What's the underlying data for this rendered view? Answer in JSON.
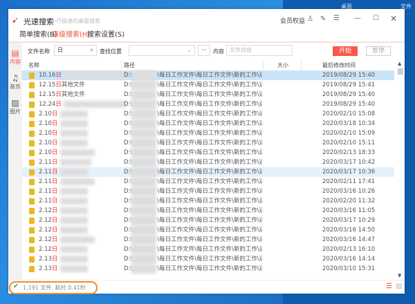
{
  "desktop": {
    "tabs": [
      "桌面",
      "文件"
    ]
  },
  "app": {
    "name": "光速搜索",
    "slogan": "小巧极速的桌面搜索",
    "member": "会员权益"
  },
  "menu": [
    {
      "label": "简单搜索(B)"
    },
    {
      "label": "高级搜索(H)"
    },
    {
      "label": "搜索设置(S)"
    }
  ],
  "sidebar": [
    {
      "label": "内容"
    },
    {
      "label": "音乐"
    },
    {
      "label": "图片"
    }
  ],
  "search": {
    "filename_label": "文件名称",
    "filename_value": "日",
    "location_label": "查找位置",
    "location_value": "",
    "more": "···",
    "content_label": "内容",
    "content_placeholder": "文件内容",
    "start": "开始",
    "pause": "暂停"
  },
  "columns": [
    "名称",
    "路径",
    "大小",
    "最后修改时间"
  ],
  "path_prefix": "D:\\",
  "path_suffix": "\\每日工作文件\\每日工作文件\\新的工作\\运营各类模",
  "rows": [
    {
      "pre": "10.16",
      "hl": "日",
      "rest": "",
      "date": "2019/08/29 15:40"
    },
    {
      "pre": "12.15",
      "hl": "日",
      "rest": "其他文件",
      "date": "2019/08/29 15:41"
    },
    {
      "pre": "12.15",
      "hl": "日",
      "rest": "其他文件",
      "date": "2019/08/29 15:40"
    },
    {
      "pre": "12.24",
      "hl": "日",
      "rest": "",
      "date": "2019/08/29 15:40"
    },
    {
      "pre": "2.10",
      "hl": "日",
      "rest": "",
      "date": "2020/02/10 15:08"
    },
    {
      "pre": "2.10",
      "hl": "日",
      "rest": "",
      "date": "2020/03/18 10:34"
    },
    {
      "pre": "2.10",
      "hl": "日",
      "rest": "",
      "date": "2020/02/10 15:09"
    },
    {
      "pre": "2.10",
      "hl": "日",
      "rest": "",
      "date": "2020/02/10 15:11"
    },
    {
      "pre": "2.10",
      "hl": "日",
      "rest": "",
      "date": "2020/02/13 18:33"
    },
    {
      "pre": "2.11",
      "hl": "日",
      "rest": "",
      "date": "2020/03/17 10:42"
    },
    {
      "pre": "2.11",
      "hl": "日",
      "rest": "",
      "date": "2020/03/17 10:36"
    },
    {
      "pre": "2.11",
      "hl": "日",
      "rest": "",
      "date": "2020/02/11 17:41"
    },
    {
      "pre": "2.11",
      "hl": "日",
      "rest": "",
      "date": "2020/03/16 10:26"
    },
    {
      "pre": "2.11",
      "hl": "日",
      "rest": "",
      "date": "2020/02/20 11:32"
    },
    {
      "pre": "2.12",
      "hl": "日",
      "rest": "",
      "date": "2020/03/16 11:05"
    },
    {
      "pre": "2.12",
      "hl": "日",
      "rest": "",
      "date": "2020/03/17 10:29"
    },
    {
      "pre": "2.12",
      "hl": "日",
      "rest": "",
      "date": "2020/03/16 14:50"
    },
    {
      "pre": "2.12",
      "hl": "日",
      "rest": "",
      "date": "2020/03/16 14:47"
    },
    {
      "pre": "2.12",
      "hl": "日",
      "rest": "",
      "date": "2020/02/13 16:10"
    },
    {
      "pre": "2.13",
      "hl": "日",
      "rest": "",
      "date": "2020/03/16 14:14"
    },
    {
      "pre": "2.13",
      "hl": "日",
      "rest": "",
      "date": "2020/03/10 15:31"
    }
  ],
  "status": "1,191 文件, 耗时 0.41秒"
}
